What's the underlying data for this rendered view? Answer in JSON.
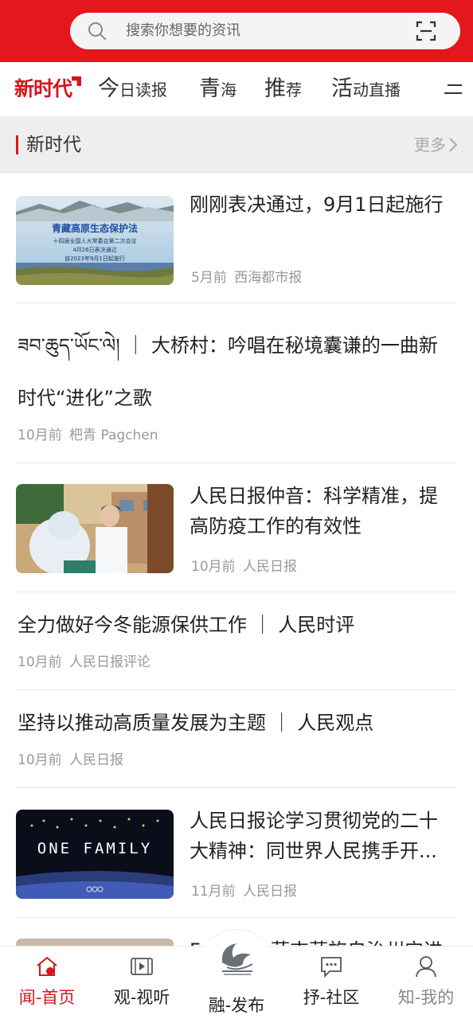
{
  "search": {
    "placeholder": "搜索你想要的资讯",
    "icon": "search-icon",
    "scan_icon": "scan-icon"
  },
  "tabs": {
    "logo": "新时代",
    "items": [
      {
        "first": "今",
        "rest": "日读报"
      },
      {
        "first": "青",
        "rest": "海"
      },
      {
        "first": "推",
        "rest": "荐"
      },
      {
        "first": "活",
        "rest": "动直播"
      }
    ],
    "menu_icon": "menu-icon"
  },
  "section": {
    "title": "新时代",
    "more": "更多"
  },
  "news": [
    {
      "title": "刚刚表决通过，9月1日起施行",
      "time": "5月前",
      "source": "西海都市报",
      "thumb": {
        "heading": "青藏高原生态保护法",
        "line1": "十四届全国人大常委会第二次会议",
        "line2": "4月26日表决通过",
        "line3": "自2023年9月1日起施行"
      }
    },
    {
      "title_line1": "ཟབ་ཆུད་ཡོང་ལེ། ｜ 大桥村：吟唱在秘境囊谦的一曲新",
      "title_line2": "时代“进化”之歌",
      "time": "10月前",
      "source": "杷青  Pagchen"
    },
    {
      "title_line1": "人民日报仲音：科学精准，提",
      "title_line2": "高防疫工作的有效性",
      "time": "10月前",
      "source": "人民日报"
    },
    {
      "title": "全力做好今冬能源保供工作 ｜ 人民时评",
      "time": "10月前",
      "source": "人民日报评论"
    },
    {
      "title": "坚持以推动高质量发展为主题 ｜ 人民观点",
      "time": "10月前",
      "source": "人民日报"
    },
    {
      "title_line1": "人民日报论学习贯彻党的二十",
      "title_line2": "大精神：同世界人民携手开...",
      "time": "11月前",
      "source": "人民日报",
      "thumb": {
        "text": "ONE FAMILY"
      }
    },
    {
      "title_partial_left": "F",
      "title_partial_right": "萨吉萨旅自治州宁进"
    }
  ],
  "bottomnav": {
    "items": [
      {
        "label": "闻-首页",
        "icon": "home-icon",
        "active": true
      },
      {
        "label": "观-视听",
        "icon": "video-icon"
      },
      {
        "label": "融-发布",
        "icon": "publish-logo-icon"
      },
      {
        "label": "抒-社区",
        "icon": "chat-icon"
      },
      {
        "label": "知-我的",
        "icon": "user-icon"
      }
    ]
  },
  "colors": {
    "brand_red": "#e4171d",
    "active_red": "#d7151b",
    "meta_gray": "#999999"
  }
}
